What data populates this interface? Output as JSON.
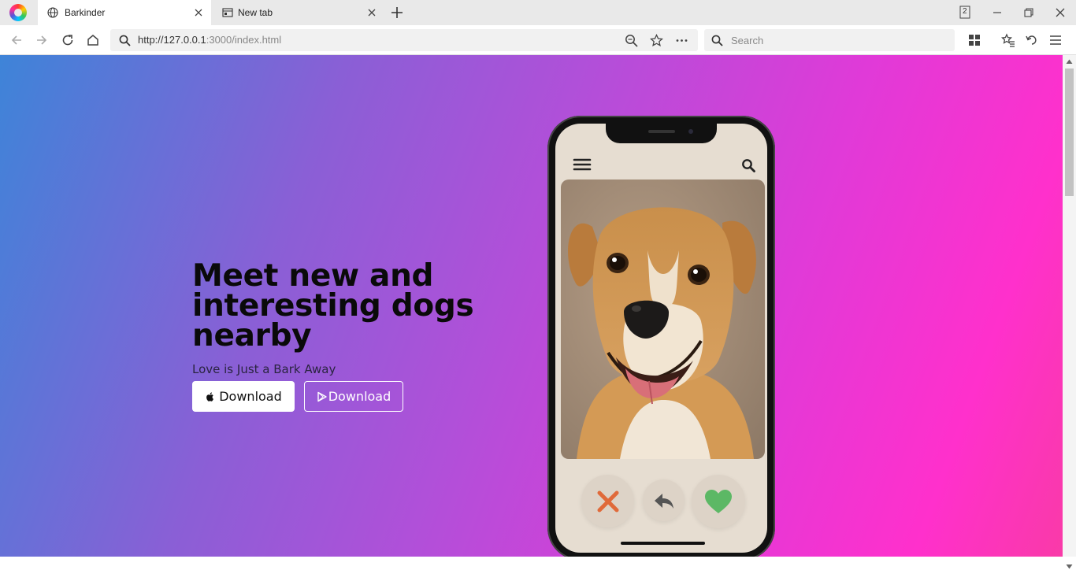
{
  "browser": {
    "tabs": [
      {
        "title": "Barkinder",
        "active": true,
        "icon": "globe-icon"
      },
      {
        "title": "New tab",
        "active": false,
        "icon": "newtab-icon"
      }
    ],
    "tab_count_badge": "2",
    "url_host": "http://127.0.0.1",
    "url_rest": ":3000/index.html",
    "search_placeholder": "Search"
  },
  "hero": {
    "title": "Meet new and interesting dogs nearby",
    "subtitle": "Love is Just a Bark Away",
    "apple_button": "Download",
    "play_button": "Download"
  },
  "phone": {
    "menu_icon": "hamburger-menu-icon",
    "search_icon": "search-icon",
    "actions": [
      "nope-x-icon",
      "undo-arrow-icon",
      "like-heart-icon"
    ]
  },
  "colors": {
    "gradient_start": "#3e84d8",
    "gradient_mid": "#b24fd9",
    "gradient_end": "#ff30cc",
    "nope": "#e06a3a",
    "like": "#5cb865",
    "undo": "#555555"
  }
}
